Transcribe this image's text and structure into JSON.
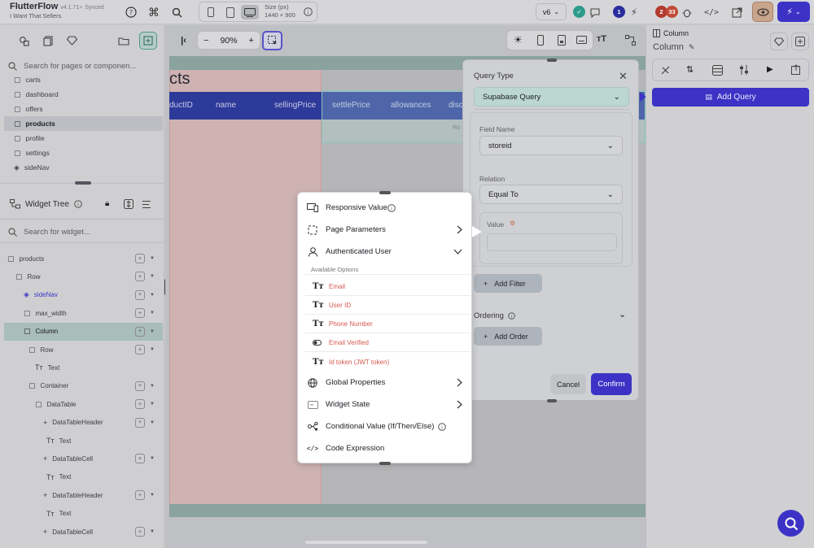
{
  "app": {
    "name": "FlutterFlow",
    "version": "v4.1.71+",
    "sync_status": "Synced",
    "project": "I Want That Sellers"
  },
  "topbar": {
    "size_label": "Size (px)",
    "size_value": "1440 × 900",
    "version_select": "v6",
    "badge_blue": "1",
    "badge_red_1": "2",
    "badge_red_2": "33"
  },
  "left_panel": {
    "search_pages_placeholder": "Search for pages or componen...",
    "pages": [
      "carts",
      "dashboard",
      "offers",
      "products",
      "profile",
      "settings",
      "sideNav"
    ],
    "selected_page": "products",
    "widget_tree_title": "Widget Tree",
    "search_widget_placeholder": "Search for widget...",
    "tree": [
      {
        "label": "products",
        "indent": 0
      },
      {
        "label": "Row",
        "indent": 1
      },
      {
        "label": "sideNav",
        "indent": 2
      },
      {
        "label": "max_width",
        "indent": 2
      },
      {
        "label": "Column",
        "indent": 3
      },
      {
        "label": "Row",
        "indent": 4
      },
      {
        "label": "Text",
        "indent": 5
      },
      {
        "label": "Container",
        "indent": 4
      },
      {
        "label": "DataTable",
        "indent": 5
      },
      {
        "label": "DataTableHeader",
        "indent": 6
      },
      {
        "label": "Text",
        "indent": 7
      },
      {
        "label": "DataTableCell",
        "indent": 6
      },
      {
        "label": "Text",
        "indent": 7
      },
      {
        "label": "DataTableHeader",
        "indent": 6
      },
      {
        "label": "Text",
        "indent": 7
      },
      {
        "label": "DataTableCell",
        "indent": 6
      }
    ]
  },
  "canvas": {
    "zoom": "90%",
    "page_heading": "cts",
    "table_headers": [
      "ductID",
      "name",
      "sellingPrice",
      "settlePrice",
      "allowances",
      "disc"
    ],
    "faint_text": "Ro"
  },
  "query_panel": {
    "query_type_label": "Query Type",
    "query_type_value": "Supabase Query",
    "field_name_label": "Field Name",
    "field_name_value": "storeid",
    "relation_label": "Relation",
    "relation_value": "Equal To",
    "value_label": "Value",
    "add_filter": "Add Filter",
    "ordering_label": "Ordering",
    "add_order": "Add Order",
    "cancel": "Cancel",
    "confirm": "Confirm"
  },
  "right_panel": {
    "widget_type": "Column",
    "widget_name": "Column",
    "add_query": "Add Query"
  },
  "menu": {
    "items_top": [
      "Responsive Value",
      "Page Parameters",
      "Authenticated User"
    ],
    "available_options_label": "Available Options",
    "auth_options": [
      "Email",
      "User ID",
      "Phone Number",
      "Email Verified",
      "Id token (JWT token)"
    ],
    "items_bottom": [
      "Global Properties",
      "Widget State",
      "Conditional Value (If/Then/Else)",
      "Code Expression"
    ]
  },
  "colors": {
    "accent": "#3c33c6",
    "header_blue": "#2e3a9a",
    "option_red": "#d7584f",
    "selected_teal": "#a9bdb9"
  }
}
